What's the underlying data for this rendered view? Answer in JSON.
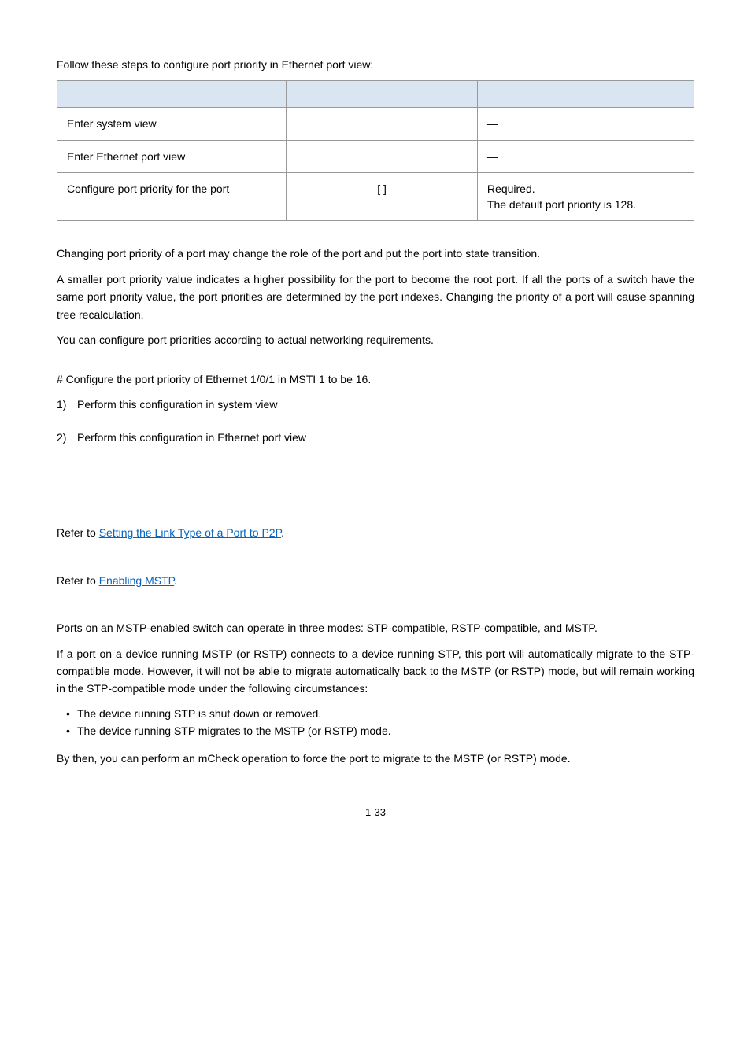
{
  "intro_line": "Follow these steps to configure port priority in Ethernet port view:",
  "table": {
    "rows": [
      {
        "op": "Enter system view",
        "cmd": "",
        "desc": "—"
      },
      {
        "op": "Enter Ethernet port view",
        "cmd": "",
        "desc": "—"
      },
      {
        "op": "Configure port priority for the port",
        "cmd": "[                               ]",
        "desc_line1": "Required.",
        "desc_line2": "The default port priority is 128."
      }
    ]
  },
  "para1": "Changing port priority of a port may change the role of the port and put the port into state transition.",
  "para2": "A smaller port priority value indicates a higher possibility for the port to become the root port. If all the ports of a switch have the same port priority value, the port priorities are determined by the port indexes. Changing the priority of a port will cause spanning tree recalculation.",
  "para3": "You can configure port priorities according to actual networking requirements.",
  "config_intro": "# Configure the port priority of Ethernet 1/0/1 in MSTI 1 to be 16.",
  "item1_num": "1)",
  "item1_text": "Perform this configuration in system view",
  "item2_num": "2)",
  "item2_text": "Perform this configuration in Ethernet port view",
  "refer1_prefix": "Refer to ",
  "refer1_link": "Setting the Link Type of a Port to P2P",
  "refer1_suffix": ".",
  "refer2_prefix": "Refer to ",
  "refer2_link": "Enabling MSTP",
  "refer2_suffix": ".",
  "mstp_para1": "Ports on an MSTP-enabled switch can operate in three modes: STP-compatible, RSTP-compatible, and MSTP.",
  "mstp_para2": "If a port on a device running MSTP (or RSTP) connects to a device running STP, this port will automatically migrate to the STP-compatible mode. However, it will not be able to migrate automatically back to the MSTP (or RSTP) mode, but will remain working in the STP-compatible mode under the following circumstances:",
  "bullet1": "The device running STP is shut down or removed.",
  "bullet2": "The device running STP migrates to the MSTP (or RSTP) mode.",
  "mstp_para3": "By then, you can perform an mCheck operation to force the port to migrate to the MSTP (or RSTP) mode.",
  "page_number": "1-33"
}
